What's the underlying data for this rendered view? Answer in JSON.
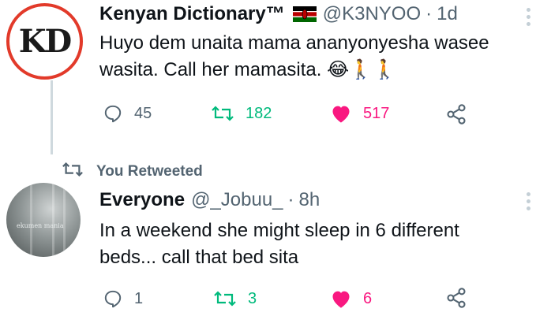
{
  "tweet1": {
    "avatar_text": "KD",
    "display_name": "Kenyan Dictionary™",
    "flag": "kenya-flag",
    "handle": "@K3NYOO",
    "separator": "·",
    "time": "1d",
    "text_line1": "Huyo dem unaita mama ananyonyesha wasee",
    "text_line2": "wasita. Call her mamasita. 😂🚶🚶",
    "replies": "45",
    "retweets": "182",
    "likes": "517"
  },
  "retweet_banner": {
    "label": "You Retweeted"
  },
  "tweet2": {
    "avatar_text": "ekumen mania",
    "display_name": "Everyone",
    "handle": "@_Jobuu_",
    "separator": "·",
    "time": "8h",
    "text_line1": "In a weekend she might sleep in 6 different",
    "text_line2": "beds... call that bed sita",
    "replies": "1",
    "retweets": "3",
    "likes": "6"
  },
  "colors": {
    "like": "#f91880",
    "retweet": "#00ba7c",
    "secondary": "#536471"
  }
}
